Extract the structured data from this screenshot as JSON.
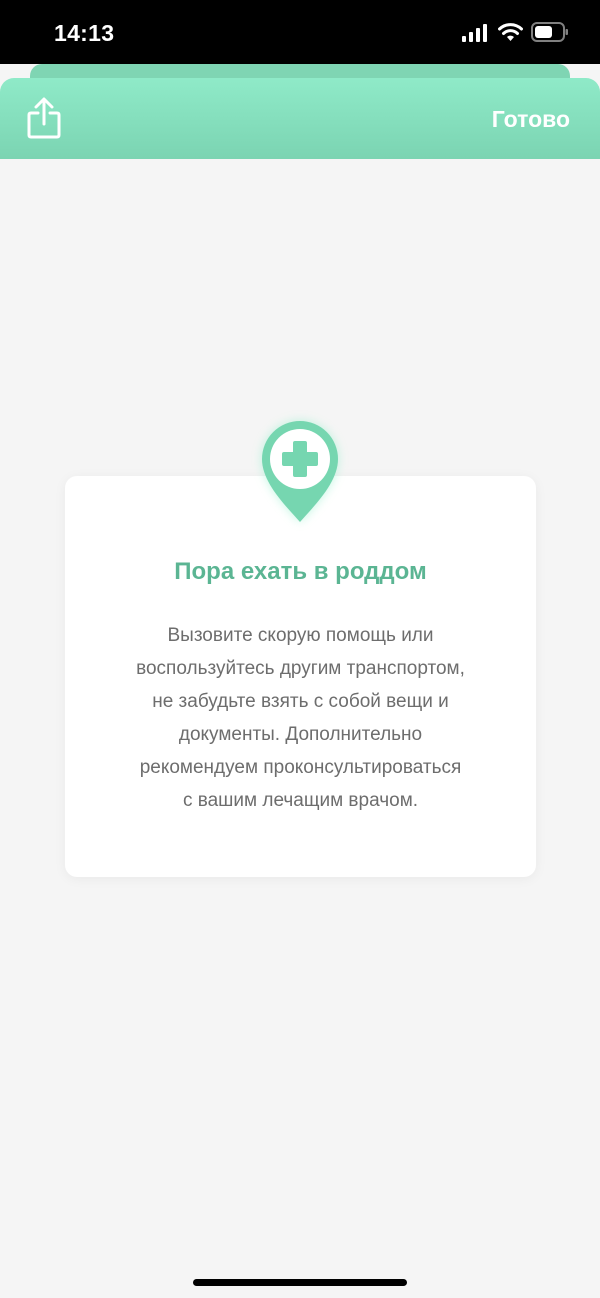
{
  "status_bar": {
    "time": "14:13",
    "icons": [
      "signal-icon",
      "wifi-icon",
      "battery-icon"
    ]
  },
  "header": {
    "share_icon": "share-icon",
    "done_label": "Готово"
  },
  "card": {
    "icon": "hospital-pin-icon",
    "title": "Пора ехать в роддом",
    "lines": [
      "Вызовите скорую помощь или",
      "воспользуйтесь другим транспортом,",
      "не забудьте взять с собой вещи и",
      "документы. Дополнительно",
      "рекомендуем проконсультироваться",
      "с вашим лечащим врачом."
    ]
  },
  "colors": {
    "header_top": "#8feac8",
    "header_bottom": "#7bd4b2",
    "accent": "#5bb593",
    "pin_fill": "#76d6b0",
    "text": "#6d6d6d",
    "background": "#f5f5f5"
  }
}
